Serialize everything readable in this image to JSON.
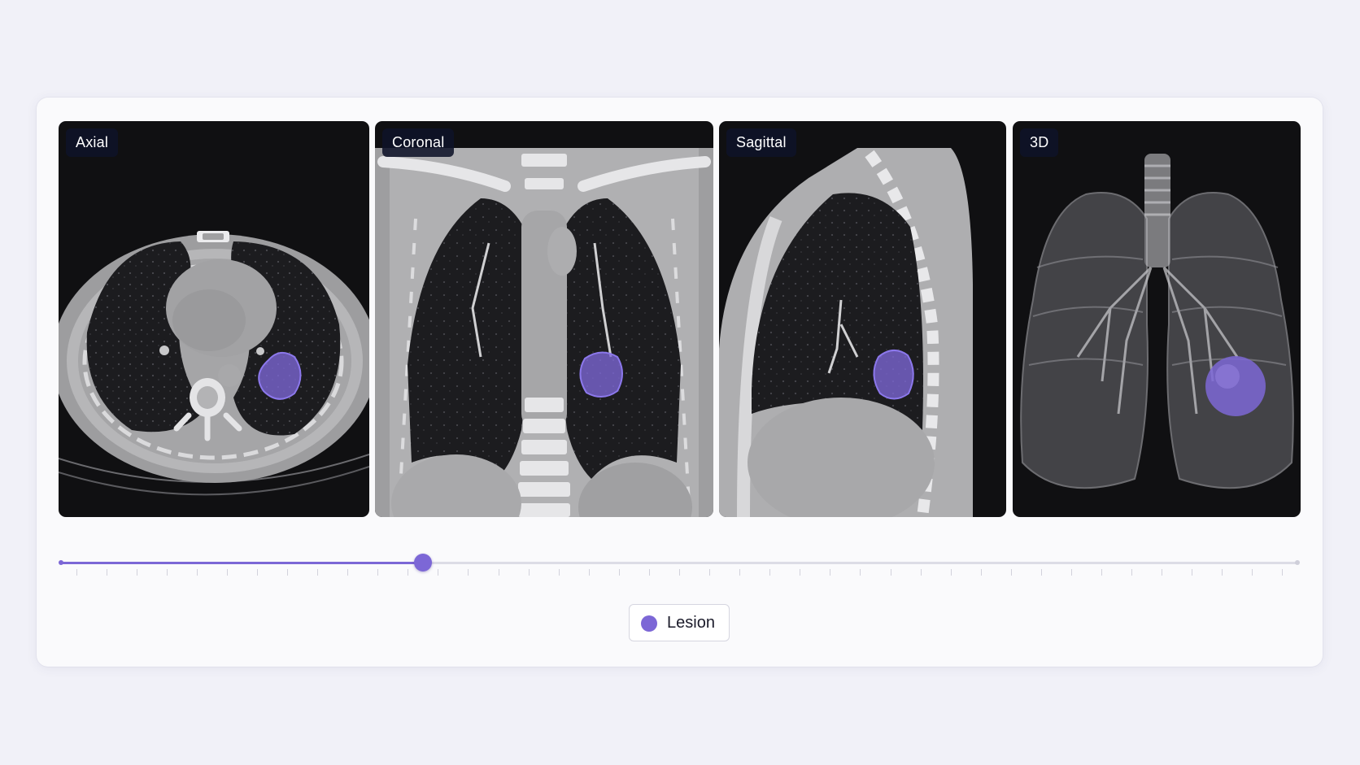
{
  "viewer": {
    "views": [
      {
        "label": "Axial"
      },
      {
        "label": "Coronal"
      },
      {
        "label": "Sagittal"
      },
      {
        "label": "3D"
      }
    ],
    "slice_slider": {
      "position_fraction": 0.293,
      "tick_count": 40
    }
  },
  "legend": {
    "label": "Lesion",
    "color": "#7c67d6"
  },
  "colors": {
    "accent": "#7c67d6",
    "viewport_bg": "#101012",
    "page_bg": "#f1f1f8"
  }
}
